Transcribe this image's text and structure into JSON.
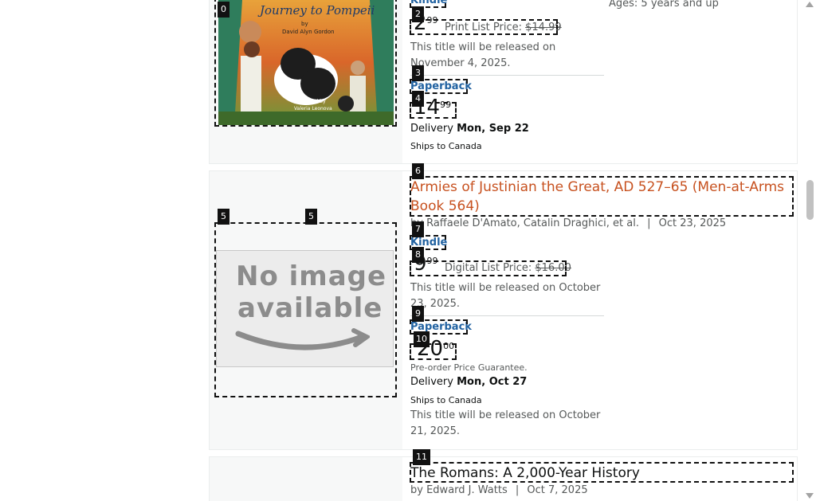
{
  "item1": {
    "cover": {
      "title": "Journey to Pompeii",
      "by": "by",
      "author": "David Alyn Gordon",
      "illustrated_by": "Illustrated by",
      "illustrator": "Valeria Leonova"
    },
    "kindle_label": "Kindle",
    "kindle_price_whole": "2",
    "kindle_price_frac": "99",
    "print_list_label": "Print List Price:",
    "print_list_price": "$14.99",
    "kindle_release_note": "This title will be released on November 4, 2025.",
    "paperback_label": "Paperback",
    "paperback_price_whole": "14",
    "paperback_price_frac": "99",
    "delivery_label": "Delivery",
    "delivery_date": "Mon, Sep 22",
    "ships_to": "Ships to Canada",
    "ages": "Ages: 5 years and up"
  },
  "item2": {
    "no_image_line1": "No image",
    "no_image_line2": "available",
    "title": "Armies of Justinian the Great, AD 527–65 (Men-at-Arms Book 564)",
    "by": "by",
    "authors": "Raffaele D'Amato, Catalin Draghici, et al.",
    "sep": "|",
    "date": "Oct 23, 2025",
    "kindle_label": "Kindle",
    "kindle_price_whole": "9",
    "kindle_price_frac": "99",
    "digital_list_label": "Digital List Price:",
    "digital_list_price": "$16.00",
    "kindle_release_note": "This title will be released on October 23, 2025.",
    "paperback_label": "Paperback",
    "paperback_price_whole": "20",
    "paperback_price_frac": "00",
    "preorder": "Pre-order Price Guarantee.",
    "delivery_label": "Delivery",
    "delivery_date": "Mon, Oct 27",
    "ships_to": "Ships to Canada",
    "paperback_release_note": "This title will be released on October 21, 2025."
  },
  "item3": {
    "title": "The Romans: A 2,000-Year History",
    "by": "by",
    "author": "Edward J. Watts",
    "sep": "|",
    "date": "Oct 7, 2025"
  },
  "badges": [
    "0",
    "2",
    "3",
    "4",
    "5",
    "5",
    "6",
    "7",
    "8",
    "9",
    "10",
    "11"
  ]
}
